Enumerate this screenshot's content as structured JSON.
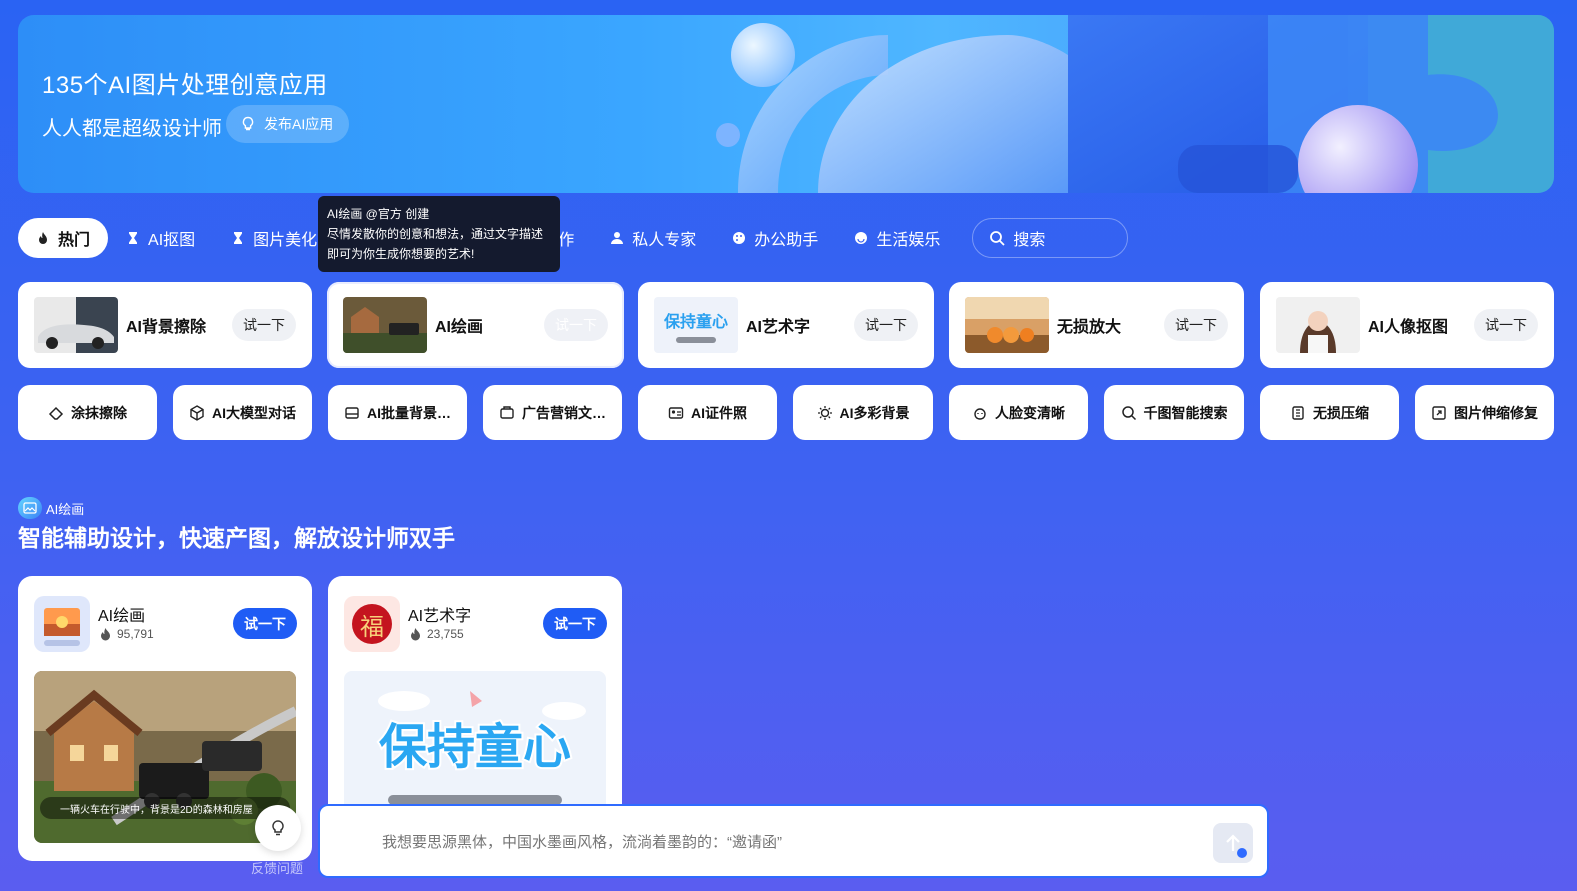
{
  "banner": {
    "title": "135个AI图片处理创意应用",
    "subtitle": "人人都是超级设计师",
    "publish_label": "发布AI应用"
  },
  "tabs": [
    {
      "label": "热门",
      "icon": "fire-icon"
    },
    {
      "label": "AI抠图",
      "icon": "hourglass-icon"
    },
    {
      "label": "图片美化",
      "icon": "hourglass-icon"
    },
    {
      "label": "AI写作",
      "icon": "book-icon"
    },
    {
      "label": "私人专家",
      "icon": "person-icon"
    },
    {
      "label": "办公助手",
      "icon": "palette-icon"
    },
    {
      "label": "生活娱乐",
      "icon": "smile-icon"
    }
  ],
  "search": {
    "label": "搜索"
  },
  "tooltip": {
    "line1": "AI绘画 @官方 创建",
    "line2": "尽情发散你的创意和想法，通过文字描述",
    "line3": "即可为你生成你想要的艺术!"
  },
  "features": [
    {
      "name": "AI背景擦除",
      "try": "试一下"
    },
    {
      "name": "AI绘画",
      "try": "试一下"
    },
    {
      "name": "AI艺术字",
      "try": "试一下"
    },
    {
      "name": "无损放大",
      "try": "试一下"
    },
    {
      "name": "AI人像抠图",
      "try": "试一下"
    }
  ],
  "tools": [
    {
      "label": "涂抹擦除",
      "icon": "eraser-icon"
    },
    {
      "label": "AI大模型对话",
      "icon": "cube-icon"
    },
    {
      "label": "AI批量背景…",
      "icon": "layers-icon"
    },
    {
      "label": "广告营销文…",
      "icon": "ad-icon"
    },
    {
      "label": "AI证件照",
      "icon": "id-card-icon"
    },
    {
      "label": "AI多彩背景",
      "icon": "sun-icon"
    },
    {
      "label": "人脸变清晰",
      "icon": "face-icon"
    },
    {
      "label": "千图智能搜索",
      "icon": "search-icon"
    },
    {
      "label": "无损压缩",
      "icon": "compress-icon"
    },
    {
      "label": "图片伸缩修复",
      "icon": "resize-icon"
    }
  ],
  "section": {
    "tag": "AI绘画",
    "title": "智能辅助设计，快速产图，解放设计师双手"
  },
  "apps": [
    {
      "name": "AI绘画",
      "uses": "95,791",
      "try": "试一下",
      "caption": "一辆火车在行驶中，背景是2D的森林和房屋"
    },
    {
      "name": "AI艺术字",
      "uses": "23,755",
      "try": "试一下",
      "icon_char": "福"
    }
  ],
  "feedback": {
    "label": "反馈问题"
  },
  "prompt": {
    "placeholder": "我想要思源黑体，中国水墨画风格，流淌着墨韵的：“邀请函”"
  }
}
